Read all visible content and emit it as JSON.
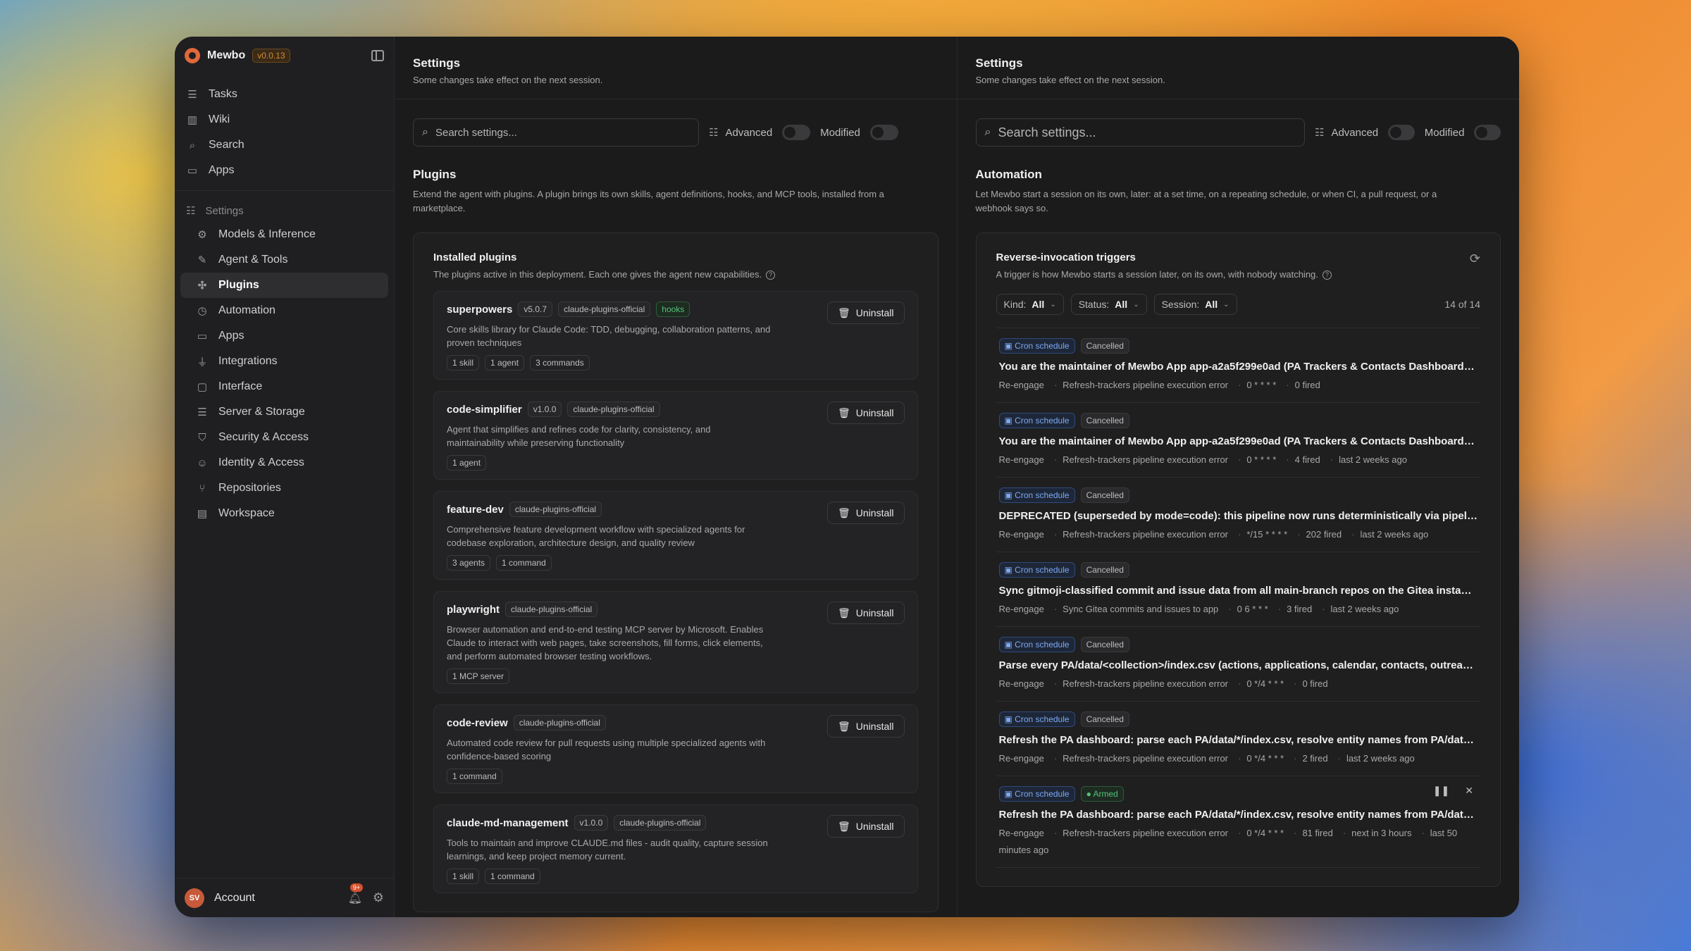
{
  "app": {
    "name": "Mewbo",
    "version": "v0.0.13"
  },
  "nav": [
    {
      "label": "Tasks",
      "icon": "checklist-icon"
    },
    {
      "label": "Wiki",
      "icon": "book-icon"
    },
    {
      "label": "Search",
      "icon": "search-icon"
    },
    {
      "label": "Apps",
      "icon": "window-icon"
    }
  ],
  "settings_nav": {
    "label": "Settings",
    "items": [
      {
        "label": "Models & Inference",
        "icon": "cpu-icon"
      },
      {
        "label": "Agent & Tools",
        "icon": "wrench-icon"
      },
      {
        "label": "Plugins",
        "icon": "puzzle-icon",
        "active": true
      },
      {
        "label": "Automation",
        "icon": "alarm-icon"
      },
      {
        "label": "Apps",
        "icon": "window-icon"
      },
      {
        "label": "Integrations",
        "icon": "plug-icon"
      },
      {
        "label": "Interface",
        "icon": "monitor-icon"
      },
      {
        "label": "Server & Storage",
        "icon": "server-icon"
      },
      {
        "label": "Security & Access",
        "icon": "shield-icon"
      },
      {
        "label": "Identity & Access",
        "icon": "users-icon"
      },
      {
        "label": "Repositories",
        "icon": "git-branch-icon"
      },
      {
        "label": "Workspace",
        "icon": "folder-icon"
      }
    ]
  },
  "footer": {
    "initials": "SV",
    "account": "Account",
    "badge": "9+"
  },
  "left": {
    "title": "Settings",
    "subtitle": "Some changes take effect on the next session.",
    "search_placeholder": "Search settings...",
    "advanced": "Advanced",
    "modified": "Modified",
    "section_title": "Plugins",
    "section_desc": "Extend the agent with plugins. A plugin brings its own skills, agent definitions, hooks, and MCP tools, installed from a marketplace.",
    "card_title": "Installed plugins",
    "card_sub": "The plugins active in this deployment. Each one gives the agent new capabilities.",
    "uninstall": "Uninstall",
    "plugins": [
      {
        "name": "superpowers",
        "tags": [
          "v5.0.7",
          "claude-plugins-official"
        ],
        "green_tag": "hooks",
        "desc": "Core skills library for Claude Code: TDD, debugging, collaboration patterns, and proven techniques",
        "chips": [
          "1 skill",
          "1 agent",
          "3 commands"
        ]
      },
      {
        "name": "code-simplifier",
        "tags": [
          "v1.0.0",
          "claude-plugins-official"
        ],
        "green_tag": "",
        "desc": "Agent that simplifies and refines code for clarity, consistency, and maintainability while preserving functionality",
        "chips": [
          "1 agent"
        ]
      },
      {
        "name": "feature-dev",
        "tags": [
          "claude-plugins-official"
        ],
        "green_tag": "",
        "desc": "Comprehensive feature development workflow with specialized agents for codebase exploration, architecture design, and quality review",
        "chips": [
          "3 agents",
          "1 command"
        ]
      },
      {
        "name": "playwright",
        "tags": [
          "claude-plugins-official"
        ],
        "green_tag": "",
        "desc": "Browser automation and end-to-end testing MCP server by Microsoft. Enables Claude to interact with web pages, take screenshots, fill forms, click elements, and perform automated browser testing workflows.",
        "chips": [
          "1 MCP server"
        ]
      },
      {
        "name": "code-review",
        "tags": [
          "claude-plugins-official"
        ],
        "green_tag": "",
        "desc": "Automated code review for pull requests using multiple specialized agents with confidence-based scoring",
        "chips": [
          "1 command"
        ]
      },
      {
        "name": "claude-md-management",
        "tags": [
          "v1.0.0",
          "claude-plugins-official"
        ],
        "green_tag": "",
        "desc": "Tools to maintain and improve CLAUDE.md files - audit quality, capture session learnings, and keep project memory current.",
        "chips": [
          "1 skill",
          "1 command"
        ]
      }
    ]
  },
  "right": {
    "title": "Settings",
    "subtitle": "Some changes take effect on the next session.",
    "search_placeholder": "Search settings...",
    "advanced": "Advanced",
    "modified": "Modified",
    "section_title": "Automation",
    "section_desc": "Let Mewbo start a session on its own, later: at a set time, on a repeating schedule, or when CI, a pull request, or a webhook says so.",
    "card_title": "Reverse-invocation triggers",
    "card_sub": "A trigger is how Mewbo starts a session later, on its own, with nobody watching.",
    "filters": [
      {
        "label": "Kind:",
        "value": "All"
      },
      {
        "label": "Status:",
        "value": "All"
      },
      {
        "label": "Session:",
        "value": "All"
      }
    ],
    "count": "14 of 14",
    "triggers": [
      {
        "kind": "Cron schedule",
        "status": "Cancelled",
        "text": "You are the maintainer of Mewbo App app-a2a5f299e0ad (PA Trackers & Contacts Dashboard). E...",
        "meta": [
          "Re-engage",
          "Refresh-trackers pipeline execution error",
          "0 * * * *",
          "0 fired"
        ]
      },
      {
        "kind": "Cron schedule",
        "status": "Cancelled",
        "text": "You are the maintainer of Mewbo App app-a2a5f299e0ad (PA Trackers & Contacts Dashboard). E...",
        "meta": [
          "Re-engage",
          "Refresh-trackers pipeline execution error",
          "0 * * * *",
          "4 fired",
          "last 2 weeks ago"
        ]
      },
      {
        "kind": "Cron schedule",
        "status": "Cancelled",
        "text": "DEPRECATED (superseded by mode=code): this pipeline now runs deterministically via pipelines/...",
        "meta": [
          "Re-engage",
          "Refresh-trackers pipeline execution error",
          "*/15 * * * *",
          "202 fired",
          "last 2 weeks ago"
        ]
      },
      {
        "kind": "Cron schedule",
        "status": "Cancelled",
        "text": "Sync gitmoji-classified commit and issue data from all main-branch repos on the Gitea instance at...",
        "meta": [
          "Re-engage",
          "Sync Gitea commits and issues to app",
          "0 6 * * *",
          "3 fired",
          "last 2 weeks ago"
        ]
      },
      {
        "kind": "Cron schedule",
        "status": "Cancelled",
        "text": "Parse every PA/data/<collection>/index.csv (actions, applications, calendar, contacts, outreach) ...",
        "meta": [
          "Re-engage",
          "Refresh-trackers pipeline execution error",
          "0 */4 * * *",
          "0 fired"
        ]
      },
      {
        "kind": "Cron schedule",
        "status": "Cancelled",
        "text": "Refresh the PA dashboard: parse each PA/data/*/index.csv, resolve entity names from PA/data/e...",
        "meta": [
          "Re-engage",
          "Refresh-trackers pipeline execution error",
          "0 */4 * * *",
          "2 fired",
          "last 2 weeks ago"
        ]
      },
      {
        "kind": "Cron schedule",
        "status": "Armed",
        "text": "Refresh the PA dashboard: parse each PA/data/*/index.csv, resolve entity names from PA/data/e...",
        "meta": [
          "Re-engage",
          "Refresh-trackers pipeline execution error",
          "0 */4 * * *",
          "81 fired",
          "next in 3 hours",
          "last 50 minutes ago"
        ]
      }
    ]
  }
}
